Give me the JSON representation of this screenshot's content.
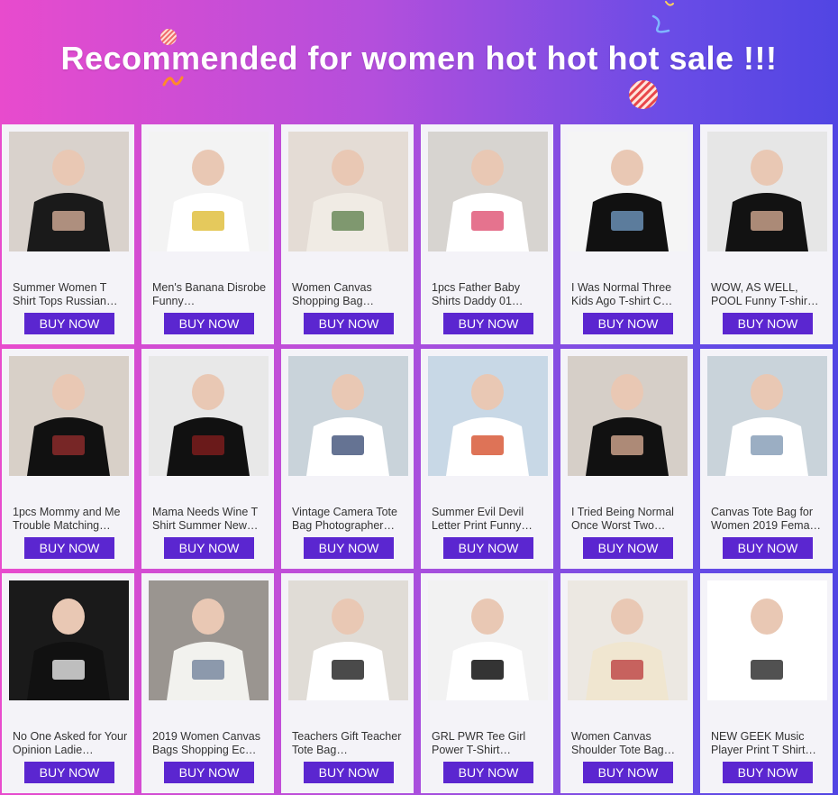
{
  "header": {
    "title": "Recommended for women hot hot hot sale !!!"
  },
  "colors": {
    "button": "#5b26d0",
    "card_bg": "#f4f3f8",
    "gradient_left": "#e84bcd",
    "gradient_right": "#5145e3"
  },
  "products": [
    {
      "title": "Summer Women T Shirt Tops Russian…",
      "button": "BUY NOW",
      "image": "women-tshirt-russian-photo"
    },
    {
      "title": "Men's Banana Disrobe Funny…",
      "button": "BUY NOW",
      "image": "banana-tshirt-photo"
    },
    {
      "title": "Women Canvas Shopping Bag…",
      "button": "BUY NOW",
      "image": "canvas-bag-photo"
    },
    {
      "title": "1pcs Father Baby Shirts Daddy 01…",
      "button": "BUY NOW",
      "image": "daddy-baby-shirt-photo"
    },
    {
      "title": "I Was Normal Three Kids Ago T-shirt C…",
      "button": "BUY NOW",
      "image": "normal-3-kids-tshirt-photo"
    },
    {
      "title": "WOW, AS WELL, POOL Funny T-shir…",
      "button": "BUY NOW",
      "image": "pool-tshirt-photo"
    },
    {
      "title": "1pcs Mommy and Me Trouble Matching…",
      "button": "BUY NOW",
      "image": "mommy-trouble-shirt-photo"
    },
    {
      "title": "Mama Needs Wine T Shirt Summer New…",
      "button": "BUY NOW",
      "image": "mama-wine-tshirt-photo"
    },
    {
      "title": "Vintage Camera Tote Bag Photographer…",
      "button": "BUY NOW",
      "image": "camera-tote-photo"
    },
    {
      "title": "Summer Evil Devil Letter Print Funny…",
      "button": "BUY NOW",
      "image": "devil-tote-photo"
    },
    {
      "title": "I Tried Being Normal Once Worst Two…",
      "button": "BUY NOW",
      "image": "tried-normal-tshirt-photo"
    },
    {
      "title": "Canvas Tote Bag for Women 2019 Fema…",
      "button": "BUY NOW",
      "image": "canvas-tote-women-photo"
    },
    {
      "title": "No One Asked for Your Opinion Ladie…",
      "button": "BUY NOW",
      "image": "no-one-asked-tshirt-photo"
    },
    {
      "title": "2019 Women Canvas Bags Shopping Ec…",
      "button": "BUY NOW",
      "image": "feminism-bag-photo"
    },
    {
      "title": "Teachers Gift Teacher Tote Bag…",
      "button": "BUY NOW",
      "image": "teacher-tote-photo"
    },
    {
      "title": "GRL PWR Tee Girl Power T-Shirt…",
      "button": "BUY NOW",
      "image": "grl-pwr-tshirt-photo"
    },
    {
      "title": "Women Canvas Shoulder Tote Bag…",
      "button": "BUY NOW",
      "image": "shoulder-tote-photo"
    },
    {
      "title": "NEW GEEK Music Player Print T Shirt…",
      "button": "BUY NOW",
      "image": "geek-music-tshirt-photo"
    }
  ]
}
